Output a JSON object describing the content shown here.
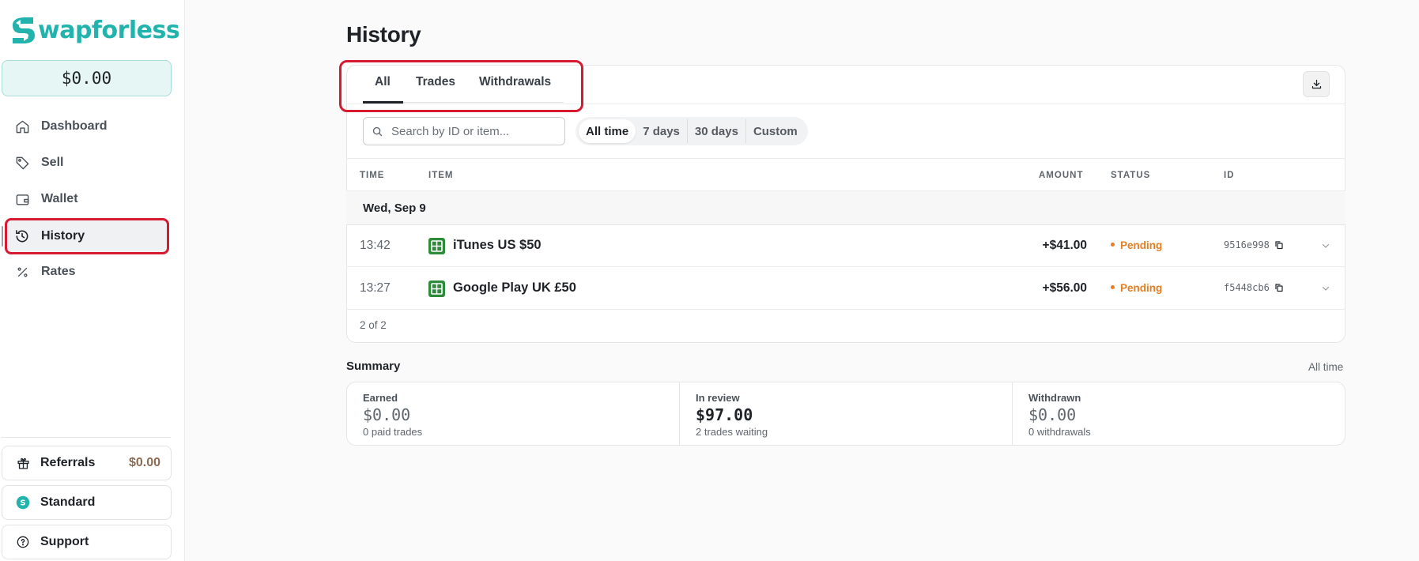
{
  "brand": {
    "name": "wapforless",
    "accent": "#22b3ad"
  },
  "sidebar": {
    "balance": "$0.00",
    "items": [
      {
        "label": "Dashboard",
        "icon": "home-icon"
      },
      {
        "label": "Sell",
        "icon": "tag-icon"
      },
      {
        "label": "Wallet",
        "icon": "wallet-icon"
      },
      {
        "label": "History",
        "icon": "history-icon",
        "active": true
      },
      {
        "label": "Rates",
        "icon": "percent-icon"
      }
    ],
    "bottom": {
      "referrals": {
        "label": "Referrals",
        "amount": "$0.00",
        "icon": "gift-icon"
      },
      "plan": {
        "label": "Standard",
        "icon": "s-badge-icon"
      },
      "support": {
        "label": "Support",
        "icon": "help-circle-icon"
      }
    }
  },
  "page": {
    "title": "History"
  },
  "tabs": [
    "All",
    "Trades",
    "Withdrawals"
  ],
  "active_tab": "All",
  "search": {
    "placeholder": "Search by ID or item...",
    "value": ""
  },
  "ranges": [
    "All time",
    "7 days",
    "30 days",
    "Custom"
  ],
  "active_range": "All time",
  "table": {
    "headers": {
      "time": "TIME",
      "item": "ITEM",
      "amount": "AMOUNT",
      "status": "STATUS",
      "id": "ID"
    },
    "group": "Wed, Sep 9",
    "rows": [
      {
        "time": "13:42",
        "item": "iTunes US $50",
        "amount": "+$41.00",
        "status": "Pending",
        "id": "9516e998"
      },
      {
        "time": "13:27",
        "item": "Google Play UK £50",
        "amount": "+$56.00",
        "status": "Pending",
        "id": "f5448cb6"
      }
    ],
    "count": "2 of 2"
  },
  "summary": {
    "title": "Summary",
    "range": "All time",
    "earned": {
      "label": "Earned",
      "value": "$0.00",
      "sub": "0 paid trades"
    },
    "in_review": {
      "label": "In review",
      "value": "$97.00",
      "sub": "2 trades waiting"
    },
    "withdrawn": {
      "label": "Withdrawn",
      "value": "$0.00",
      "sub": "0 withdrawals"
    }
  },
  "colors": {
    "pending": "#e67e22",
    "highlight": "#d51a32"
  }
}
